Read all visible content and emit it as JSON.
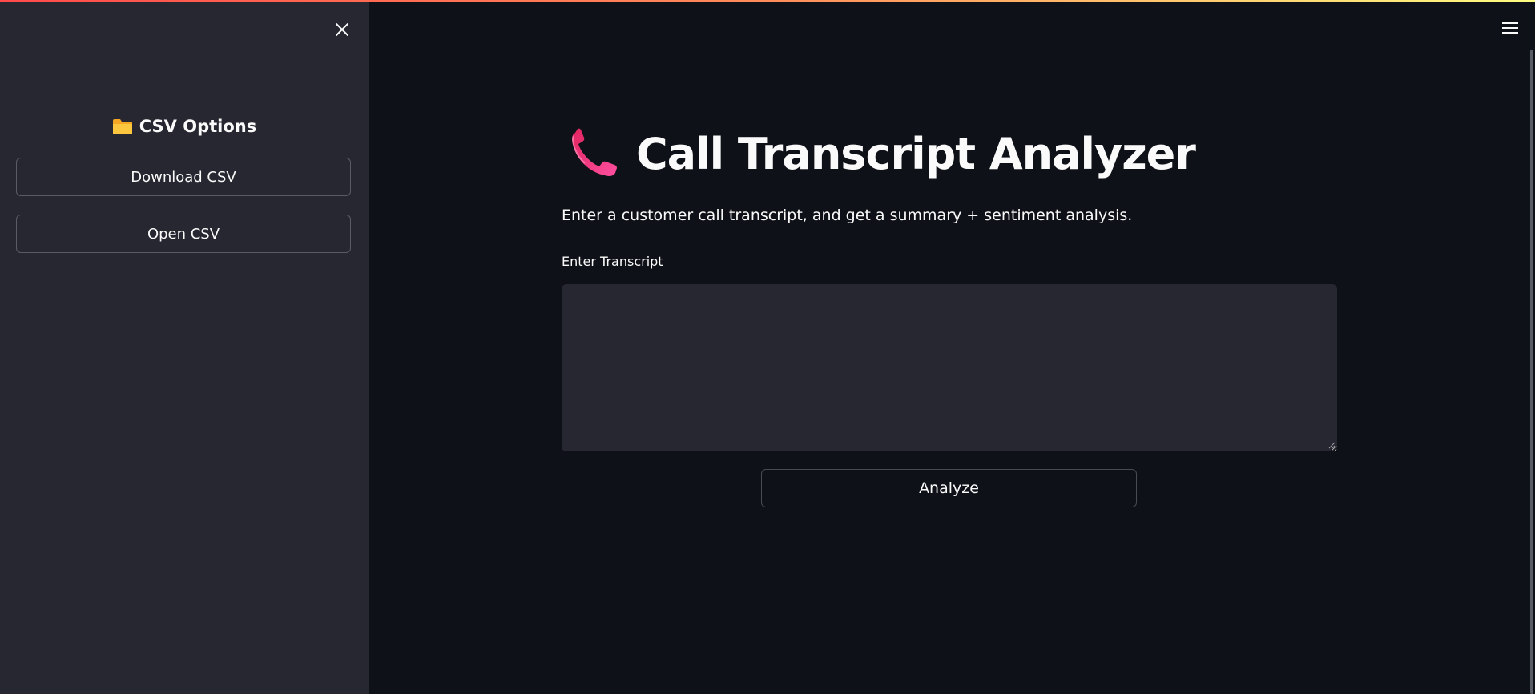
{
  "theme": {
    "accent_gradient": [
      "#ff4b4b",
      "#fffd80"
    ],
    "sidebar_bg": "#262730",
    "main_bg": "#0e1117",
    "text": "#fafafa"
  },
  "sidebar": {
    "header_icon": "folder-icon",
    "header": "CSV Options",
    "download_label": "Download CSV",
    "open_label": "Open CSV",
    "close_icon": "close-icon"
  },
  "main": {
    "title_icon": "telephone-receiver-icon",
    "title": "Call Transcript Analyzer",
    "subtitle": "Enter a customer call transcript, and get a summary + sentiment analysis.",
    "transcript_label": "Enter Transcript",
    "transcript_value": "",
    "analyze_label": "Analyze"
  },
  "toolbar": {
    "menu_icon": "hamburger-menu-icon"
  }
}
